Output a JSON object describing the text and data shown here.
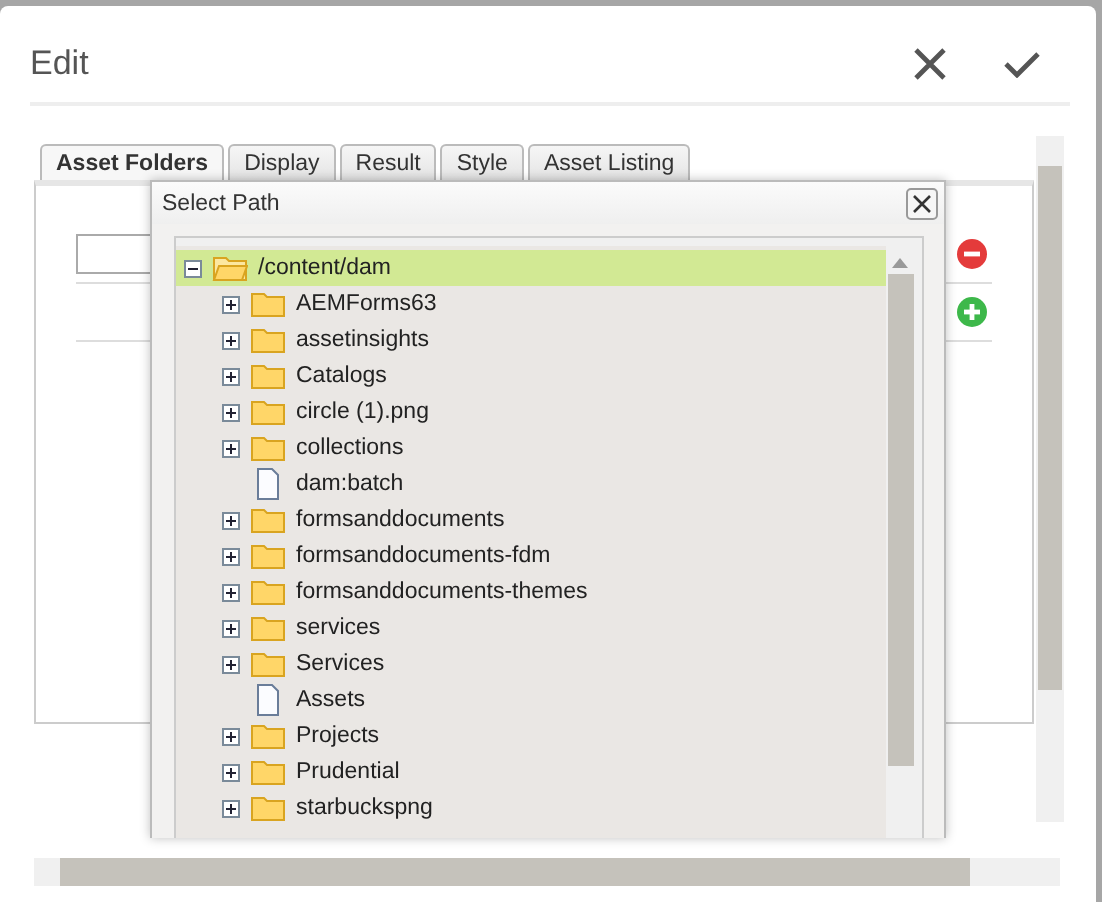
{
  "dialog": {
    "title": "Edit"
  },
  "tabs": [
    {
      "label": "Asset Folders",
      "selected": true
    },
    {
      "label": "Display",
      "selected": false
    },
    {
      "label": "Result",
      "selected": false
    },
    {
      "label": "Style",
      "selected": false
    },
    {
      "label": "Asset Listing",
      "selected": false
    }
  ],
  "select_path": {
    "title": "Select Path",
    "tree": {
      "label": "/content/dam",
      "expanded": true,
      "selected": true,
      "children": [
        {
          "label": "AEMForms63",
          "kind": "folder",
          "expanded": false,
          "selected": false
        },
        {
          "label": "assetinsights",
          "kind": "folder",
          "expanded": false,
          "selected": false
        },
        {
          "label": "Catalogs",
          "kind": "folder",
          "expanded": false,
          "selected": false
        },
        {
          "label": "circle (1).png",
          "kind": "folder",
          "expanded": false,
          "selected": false
        },
        {
          "label": "collections",
          "kind": "folder",
          "expanded": false,
          "selected": false
        },
        {
          "label": "dam:batch",
          "kind": "file",
          "selected": false
        },
        {
          "label": "formsanddocuments",
          "kind": "folder",
          "expanded": false,
          "selected": false
        },
        {
          "label": "formsanddocuments-fdm",
          "kind": "folder",
          "expanded": false,
          "selected": false
        },
        {
          "label": "formsanddocuments-themes",
          "kind": "folder",
          "expanded": false,
          "selected": false
        },
        {
          "label": "services",
          "kind": "folder",
          "expanded": false,
          "selected": false
        },
        {
          "label": "Services",
          "kind": "folder",
          "expanded": false,
          "selected": false
        },
        {
          "label": "Assets",
          "kind": "file",
          "selected": false
        },
        {
          "label": "Projects",
          "kind": "folder",
          "expanded": false,
          "selected": false
        },
        {
          "label": "Prudential",
          "kind": "folder",
          "expanded": false,
          "selected": false
        },
        {
          "label": "starbuckspng",
          "kind": "folder",
          "expanded": false,
          "selected": false
        }
      ]
    }
  }
}
